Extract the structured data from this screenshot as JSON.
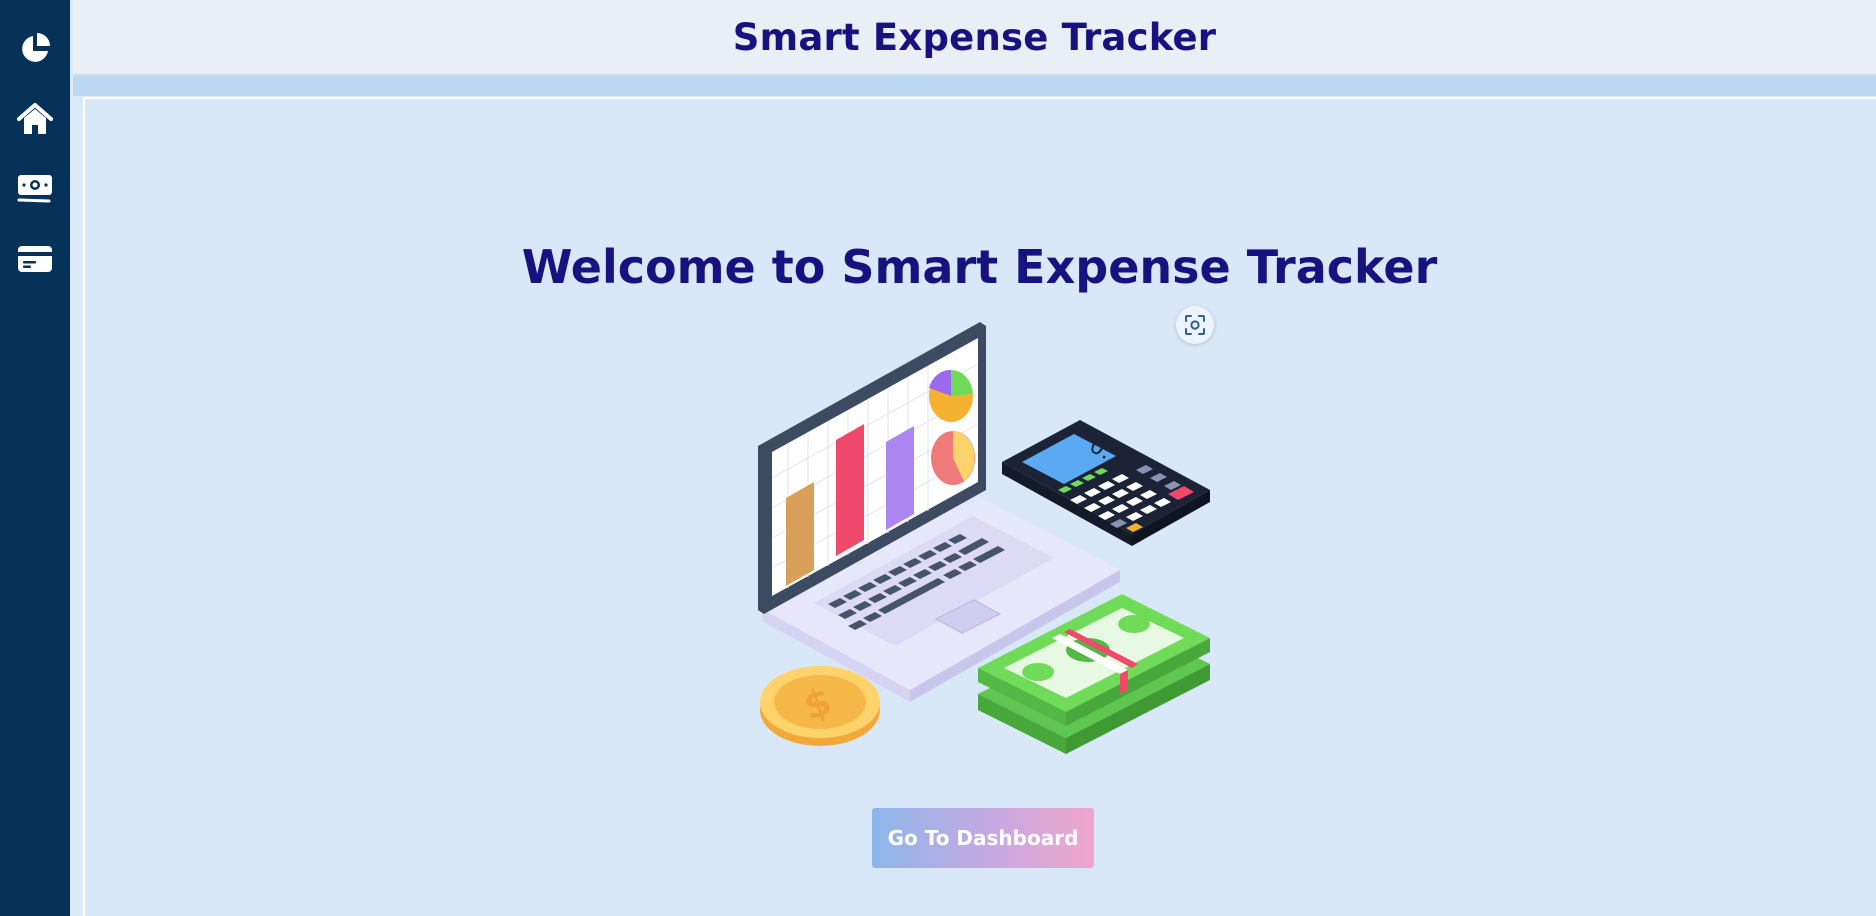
{
  "app": {
    "title": "Smart Expense Tracker"
  },
  "sidebar": {
    "items": [
      {
        "icon": "pie-chart-icon"
      },
      {
        "icon": "home-icon"
      },
      {
        "icon": "money-bill-icon"
      },
      {
        "icon": "credit-card-icon"
      }
    ]
  },
  "main": {
    "welcome_heading": "Welcome to Smart Expense Tracker",
    "cta_label": "Go To Dashboard",
    "scan_icon": "visual-search-icon"
  },
  "colors": {
    "sidebar_bg": "#06325a",
    "heading": "#17127f",
    "page_bg": "#d9e8f8"
  }
}
